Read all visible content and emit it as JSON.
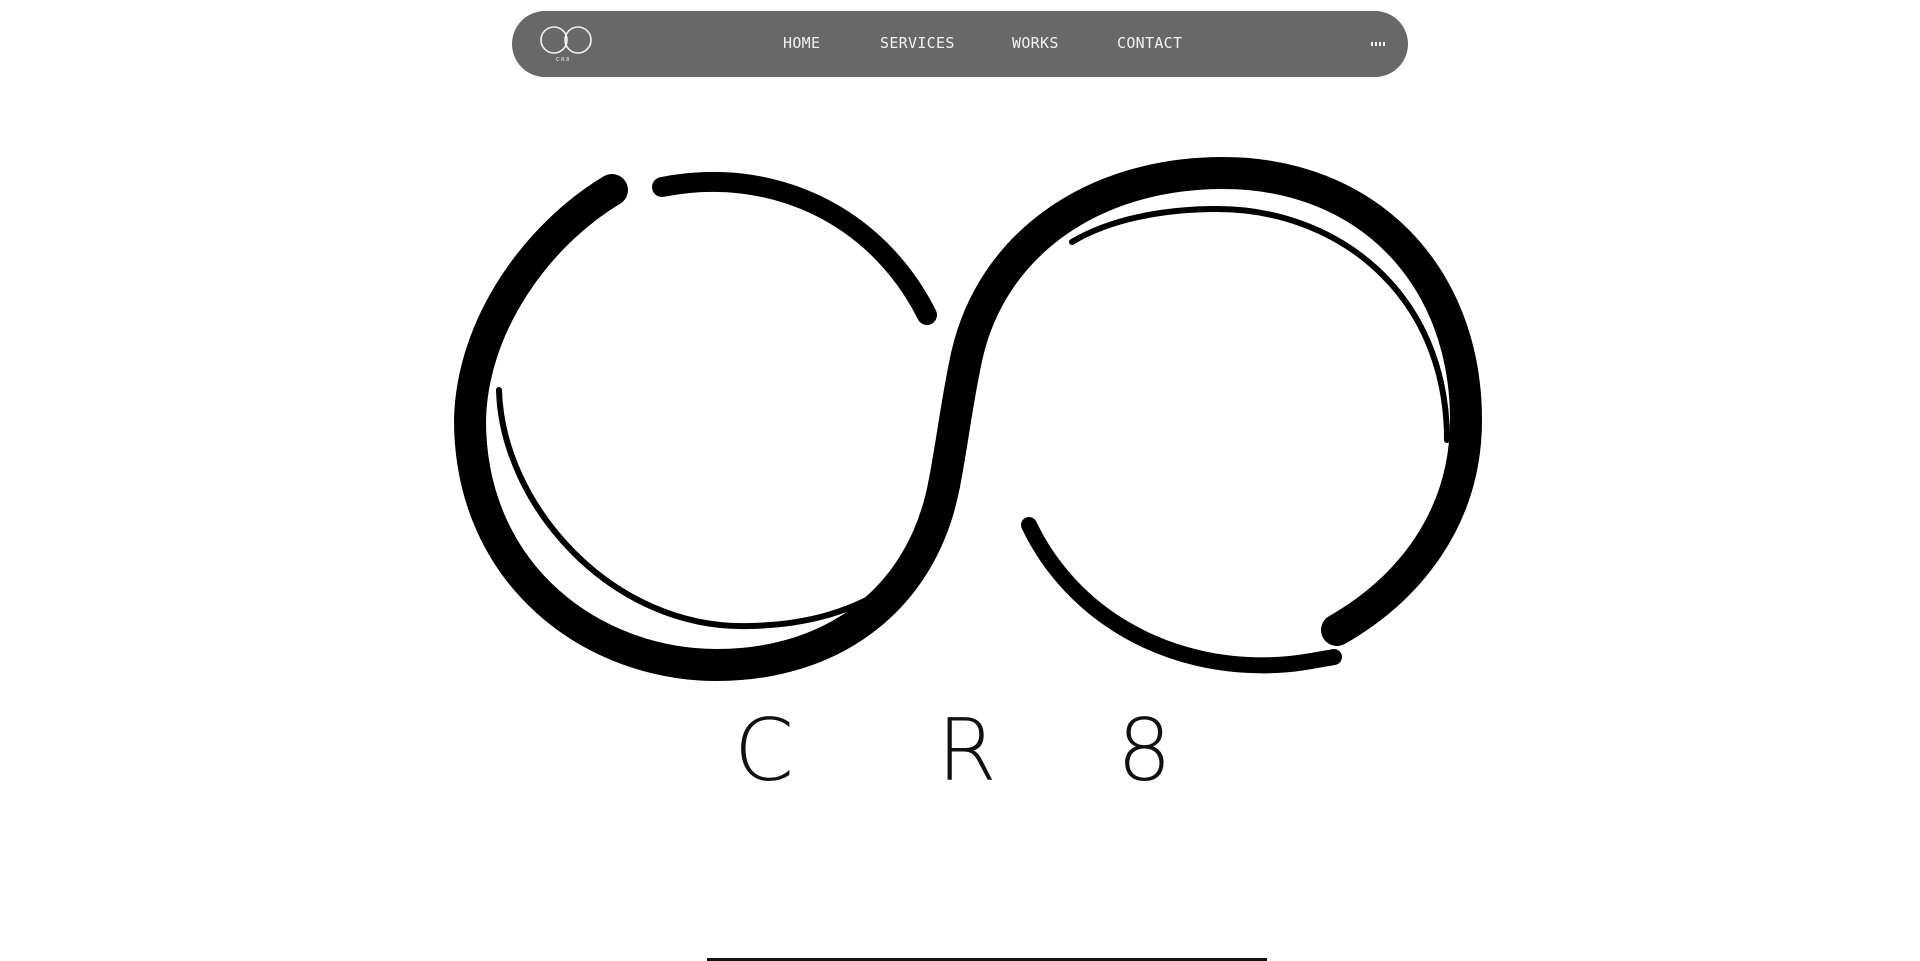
{
  "brand": {
    "logo_icon": "infinity-cr8-logo",
    "logo_caption": "C R 8",
    "letters": [
      "C",
      "R",
      "8"
    ]
  },
  "nav": {
    "links": [
      {
        "label": "HOME"
      },
      {
        "label": "SERVICES"
      },
      {
        "label": "WORKS"
      },
      {
        "label": "CONTACT"
      }
    ],
    "menu_icon": "grid-menu-icon"
  },
  "colors": {
    "nav_background": "#686868",
    "nav_text": "#f2f2f2",
    "logo_stroke": "#000000",
    "page_background": "#ffffff"
  }
}
